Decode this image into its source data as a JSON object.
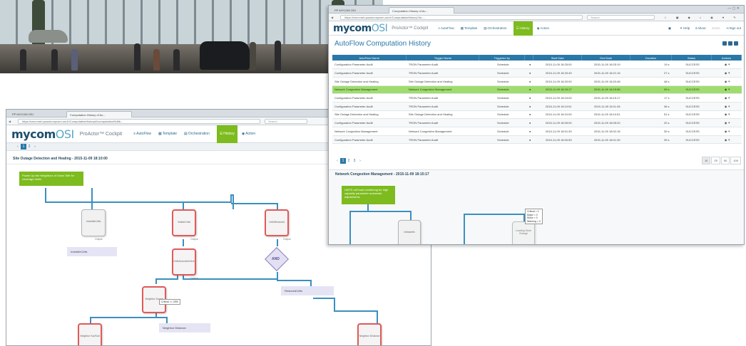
{
  "front": {
    "tab_label": "Computation History of Au...",
    "small_tab": "PP MYCOM OSI",
    "address": "https://ram-mwh.poseia.mycom-osi.fr/ComputationHistory?id=...",
    "search_placeholder": "Search",
    "logo_main": "mycom",
    "logo_osi": "OSI",
    "product": "ProActor™ Cockpit",
    "nav": [
      "AutoFlow",
      "Template",
      "Orchestration",
      "History",
      "Action"
    ],
    "active_nav": "History",
    "page_title": "AutoFlow Computation History",
    "menu_items": [
      "Help",
      "About",
      "Jones",
      "Sign out"
    ],
    "columns": [
      "AutoFlow Name",
      "Trigger Name",
      "Triggered by",
      "",
      "Start Date",
      "End Date",
      "Duration",
      "Status",
      "Actions"
    ],
    "rows": [
      [
        "Configuration Parameter Audit",
        "TRON Parameter Audit",
        "Schedule",
        "2015-11-09 18:25:00",
        "2015-11-09 18:25:19",
        "19 s",
        "SUCCESS"
      ],
      [
        "Configuration Parameter Audit",
        "TRON Parameter Audit",
        "Schedule",
        "2015-11-09 18:20:49",
        "2015-11-09 18:21:16",
        "27 s",
        "SUCCESS"
      ],
      [
        "Site Outage Detection and Healing",
        "Site Outage Detection and Healing",
        "Schedule",
        "2015-11-09 18:20:00",
        "2015-11-09 18:20:48",
        "48 s",
        "SUCCESS"
      ],
      [
        "Network Congestion Management",
        "Network Congestion Management",
        "Schedule",
        "2015-11-09 18:15:17",
        "2015-11-09 18:15:56",
        "39 s",
        "SUCCESS"
      ],
      [
        "Configuration Parameter Audit",
        "TRON Parameter Audit",
        "Schedule",
        "2015-11-09 18:15:00",
        "2015-11-09 18:15:17",
        "17 s",
        "SUCCESS"
      ],
      [
        "Configuration Parameter Audit",
        "TRON Parameter Audit",
        "Schedule",
        "2015-11-09 18:10:51",
        "2015-11-09 18:11:28",
        "36 s",
        "SUCCESS"
      ],
      [
        "Site Outage Detection and Healing",
        "Site Outage Detection and Healing",
        "Schedule",
        "2015-11-09 18:10:00",
        "2015-11-09 18:10:51",
        "51 s",
        "SUCCESS"
      ],
      [
        "Configuration Parameter Audit",
        "TRON Parameter Audit",
        "Schedule",
        "2015-11-09 18:05:00",
        "2015-11-09 18:05:20",
        "20 s",
        "SUCCESS"
      ],
      [
        "Network Congestion Management",
        "Network Congestion Management",
        "Schedule",
        "2015-11-09 18:01:39",
        "2015-11-09 18:02:18",
        "39 s",
        "SUCCESS"
      ],
      [
        "Configuration Parameter Audit",
        "TRON Parameter Audit",
        "Schedule",
        "2015-11-09 18:00:59",
        "2015-11-09 18:01:39",
        "39 s",
        "SUCCESS"
      ]
    ],
    "highlight_index": 3,
    "pages": [
      "1",
      "2",
      "3"
    ],
    "page_sizes": [
      "10",
      "25",
      "50",
      "100"
    ],
    "flow_title": "Network Congestion Management - 2015-11-09 18:15:17",
    "green_box": "UMTS cell load monitoring for high capacity parameter automatic adjustments",
    "node_label": "Initialcells",
    "node2_label": "Loading Store Change",
    "tip_lines": [
      "Critical = 0",
      "Major = 0",
      "Minor = 0",
      "Warning = 0"
    ]
  },
  "back": {
    "tab_label": "Computation History of Au...",
    "small_tab": "PP MYCOM OSI",
    "address": "https://ram-mwh.poseia.mycom-osi.fr/ComputationHistory#!/computation/9d6b...",
    "search_placeholder": "Search",
    "logo_main": "mycom",
    "logo_osi": "OSI",
    "product": "ProActor™ Cockpit",
    "nav": [
      "AutoFlow",
      "Template",
      "Orchestration",
      "History",
      "Action"
    ],
    "active_nav": "History",
    "pages": [
      "1",
      "2"
    ],
    "flow_title": "Site Outage Detection and Healing - 2015-11-09 18:10:00",
    "green_box": "Power Up the Neighbors of Down Site for coverage holes",
    "nodes": {
      "invisible": "InvisibleCells",
      "visible": "VisibleCells",
      "cells_restored": "CellsRestored",
      "cells_down": "CellsDownAreHere",
      "neighbor_downt": "Neighbor Downt",
      "neighbor_kpi": "Neighbor Kpi/Sub",
      "neighbor_distance_node": "Neighbor Distance"
    },
    "labels": {
      "invisible_cells": "InvisibleCells",
      "restored_cells": "RestoredCells",
      "neighbor_distance": "Neighbor Distance"
    },
    "and_label": "AND",
    "tip": "Critical >= 2/89",
    "sub": "Output"
  },
  "colors": {
    "accent_blue": "#2a78a8",
    "brand_green": "#7dbb1e",
    "success_green": "#2e9a2e",
    "row_highlight": "#9fdc6e"
  }
}
